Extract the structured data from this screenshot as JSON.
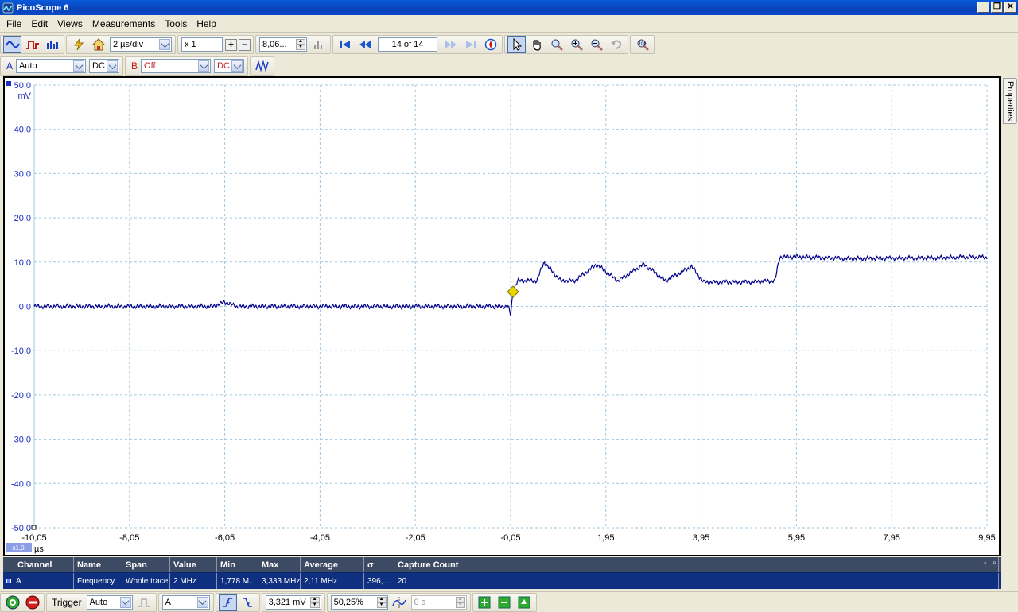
{
  "window": {
    "title": "PicoScope 6"
  },
  "menu": [
    "File",
    "Edit",
    "Views",
    "Measurements",
    "Tools",
    "Help"
  ],
  "toolbar": {
    "timebase": "2 µs/div",
    "zoom": "x 1",
    "samples": "8,06...",
    "page": "14 of 14"
  },
  "channels": {
    "a": {
      "label": "A",
      "range": "Auto",
      "coupling": "DC"
    },
    "b": {
      "label": "B",
      "range": "Off",
      "coupling": "DC"
    }
  },
  "scope": {
    "y_unit": "mV",
    "x_unit": "µs",
    "x_zoom_badge": "x1,0",
    "y_ticks": [
      "50,0",
      "40,0",
      "30,0",
      "20,0",
      "10,0",
      "0,0",
      "-10,0",
      "-20,0",
      "-30,0",
      "-40,0",
      "-50,0"
    ],
    "x_ticks": [
      "-10,05",
      "-8,05",
      "-6,05",
      "-4,05",
      "-2,05",
      "-0,05",
      "1,95",
      "3,95",
      "5,95",
      "7,95",
      "9,95"
    ],
    "trace_color": "#00008b",
    "trigger_marker_color": "#e8d800"
  },
  "chart_data": {
    "type": "line",
    "xlim": [
      -10.05,
      9.95
    ],
    "ylim": [
      -50,
      50
    ],
    "grid": true,
    "series": [
      {
        "x": [
          -10.05,
          -6.3,
          -6.05,
          -5.8,
          -2.05,
          -0.1,
          -0.05,
          0.0,
          0.1,
          0.5,
          0.65,
          1.0,
          1.3,
          1.75,
          2.2,
          2.75,
          3.2,
          3.75,
          4.0,
          4.5,
          5.0,
          5.5,
          5.55,
          5.6,
          6.0,
          7.0,
          8.0,
          9.0,
          9.6,
          9.95
        ],
        "y": [
          0.0,
          0.0,
          1.0,
          0.0,
          0.0,
          0.0,
          -2.0,
          3.5,
          5.8,
          5.8,
          10.0,
          5.8,
          5.8,
          9.5,
          5.8,
          9.5,
          5.8,
          9.0,
          5.5,
          5.5,
          5.5,
          5.8,
          8.5,
          11.2,
          11.2,
          10.8,
          10.9,
          11.0,
          11.2,
          11.1
        ]
      }
    ]
  },
  "measurements": {
    "headers": [
      "Channel",
      "Name",
      "Span",
      "Value",
      "Min",
      "Max",
      "Average",
      "σ",
      "Capture Count"
    ],
    "rows": [
      [
        "A",
        "Frequency",
        "Whole trace",
        "2 MHz",
        "1,778 M...",
        "3,333 MHz",
        "2,11 MHz",
        "396,...",
        "20"
      ]
    ],
    "controls": [
      "-",
      "▫"
    ]
  },
  "bottom": {
    "trigger_label": "Trigger",
    "trigger_mode": "Auto",
    "trigger_source": "A",
    "threshold": "3,321 mV",
    "pretrigger": "50,25%",
    "delay": "0 s"
  }
}
